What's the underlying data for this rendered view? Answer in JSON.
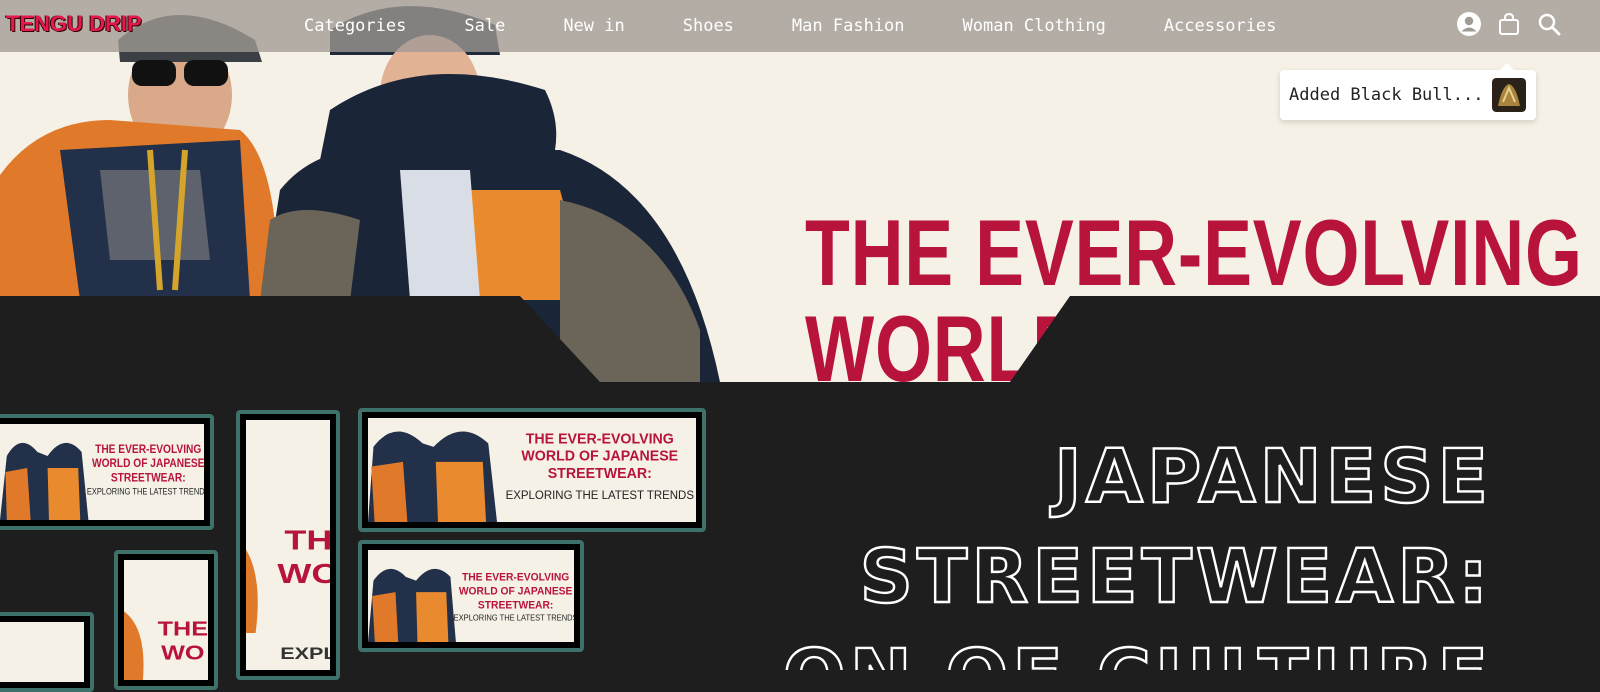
{
  "brand": {
    "name": "TENGU DRIP"
  },
  "nav": {
    "items": [
      "Categories",
      "Sale",
      "New in",
      "Shoes",
      "Man Fashion",
      "Woman Clothing",
      "Accessories"
    ],
    "icons": [
      "user-icon",
      "shopping-bag-icon",
      "search-icon"
    ]
  },
  "toast": {
    "text": "Added Black Bull..."
  },
  "hero": {
    "headline_line1": "THE EVER-EVOLVING",
    "headline_line2": "WORLD"
  },
  "thumbnail": {
    "line1": "THE EVER-EVOLVING",
    "line2": "WORLD OF JAPANESE",
    "line3": "STREETWEAR:",
    "line4": "EXPLORING THE LATEST TRENDS",
    "narrow_line1": "TH",
    "narrow_line2": "WO",
    "narrow_line3": "THE",
    "narrow_line4": "WO",
    "narrow_line5": "EXPL"
  },
  "section": {
    "title_line1": "JAPANESE",
    "title_line2": "STREETWEAR:",
    "title_line3": "FUSION OF CULTURE"
  },
  "colors": {
    "accent_red": "#b8143b",
    "brand_pink": "#e6174e",
    "frame_teal": "#3f716b",
    "cream": "#f5f1e6",
    "dark": "#1e1e1e"
  }
}
